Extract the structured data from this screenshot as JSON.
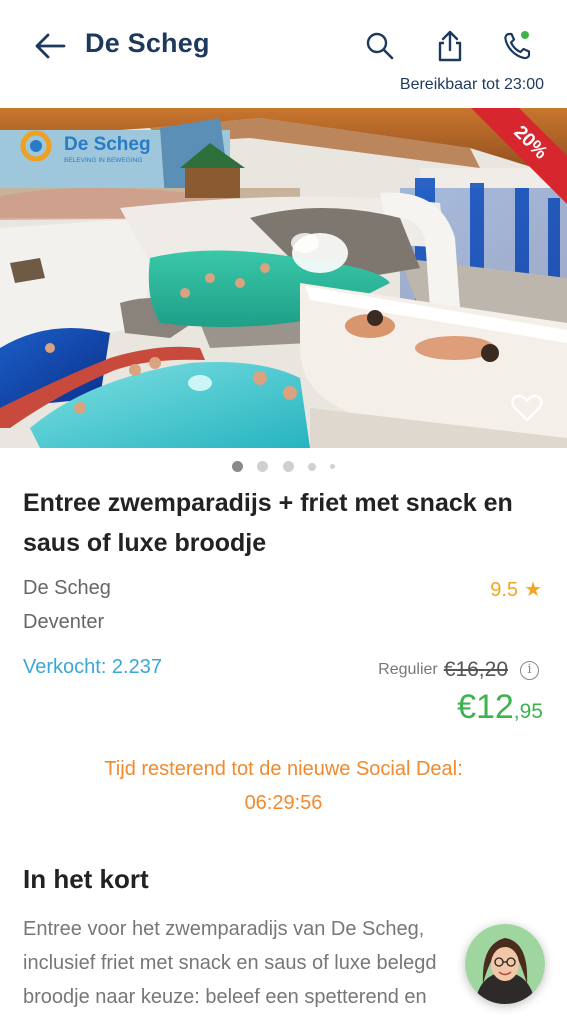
{
  "header": {
    "title": "De Scheg",
    "reachable_text": "Bereikbaar tot 23:00",
    "icons": [
      "back-arrow-icon",
      "search-icon",
      "share-icon",
      "phone-icon"
    ],
    "phone_status_color": "#3eb24f"
  },
  "hero": {
    "badge": "20%",
    "logo_text": "De Scheg",
    "logo_tagline": "BELEVING IN BEWEGING",
    "icon": "heart-outline-icon",
    "carousel_dots": 5,
    "active_dot": 1
  },
  "deal": {
    "title": "Entree zwemparadijs + friet met snack en saus of luxe broodje",
    "merchant": "De Scheg",
    "city": "Deventer",
    "rating": "9.5",
    "sold": "Verkocht: 2.237",
    "regular_label": "Regulier",
    "regular_price": "€16,20",
    "price_main": "€12",
    "price_cents": ",95"
  },
  "countdown": {
    "label": "Tijd resterend tot de nieuwe Social Deal:",
    "time": "06:29:56"
  },
  "summary": {
    "heading": "In het kort",
    "text": "Entree voor het zwemparadijs van De Scheg, inclusief friet met snack en saus of luxe belegd broodje naar keuze: beleef een spetterend en"
  },
  "colors": {
    "brand_navy": "#1d3a5c",
    "price_green": "#3eb24f",
    "sold_blue": "#3aa7d8",
    "countdown_orange": "#f08a2c",
    "rating_yellow": "#f2a623",
    "badge_red": "#d8262f"
  }
}
